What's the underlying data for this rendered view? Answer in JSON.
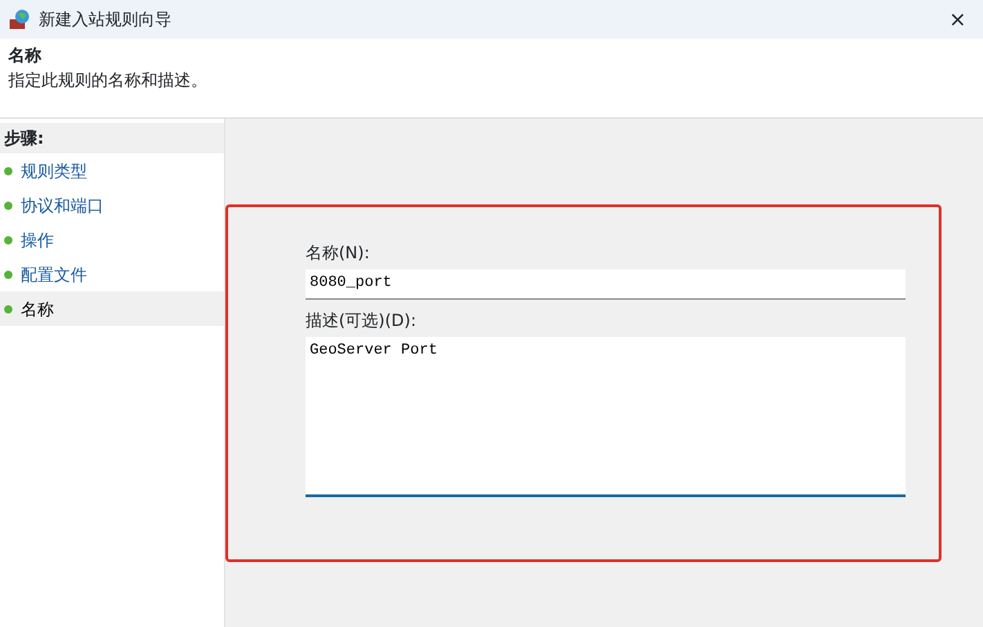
{
  "window": {
    "title": "新建入站规则向导",
    "close": "×"
  },
  "header": {
    "title": "名称",
    "subtitle": "指定此规则的名称和描述。"
  },
  "steps": {
    "heading": "步骤:",
    "items": [
      {
        "label": "规则类型",
        "selected": false
      },
      {
        "label": "协议和端口",
        "selected": false
      },
      {
        "label": "操作",
        "selected": false
      },
      {
        "label": "配置文件",
        "selected": false
      },
      {
        "label": "名称",
        "selected": true
      }
    ]
  },
  "form": {
    "name_label": "名称(N):",
    "name_value": "8080_port",
    "description_label": "描述(可选)(D):",
    "description_value": "GeoServer Port"
  },
  "annotation": {
    "kind": "frame",
    "color": "#e0302a"
  }
}
